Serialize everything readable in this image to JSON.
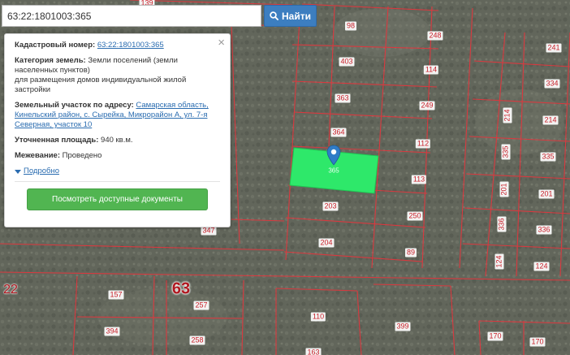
{
  "search": {
    "value": "63:22:1801003:365",
    "button_label": "Найти"
  },
  "popup": {
    "cadastral_label": "Кадастровый номер:",
    "cadastral_value": "63:22:1801003:365",
    "category_label": "Категория земель:",
    "category_value": "Земли поселений (земли населенных пунктов)",
    "purpose_value": "для размещения домов индивидуальной жилой застройки",
    "address_label": "Земельный участок по адресу:",
    "address_value": "Самарская область, Кинельский район, с. Сырейка, Микрорайон А, ул. 7-я Северная, участок 10",
    "area_label": "Уточненная площадь:",
    "area_value": "940 кв.м.",
    "survey_label": "Межевание:",
    "survey_value": "Проведено",
    "more_label": "Подробно",
    "docs_button": "Посмотреть доступные документы",
    "close_symbol": "×"
  },
  "selected_plot": {
    "label": "365",
    "color": "#2ee86a"
  },
  "colors": {
    "boundary": "#d9393f",
    "accent": "#3c7ec0",
    "docs_button": "#51b551"
  },
  "plots": [
    {
      "label": "98"
    },
    {
      "label": "248"
    },
    {
      "label": "241"
    },
    {
      "label": "403"
    },
    {
      "label": "114"
    },
    {
      "label": "334"
    },
    {
      "label": "363"
    },
    {
      "label": "249"
    },
    {
      "label": "214"
    },
    {
      "label": "214"
    },
    {
      "label": "364"
    },
    {
      "label": "112"
    },
    {
      "label": "335"
    },
    {
      "label": "335"
    },
    {
      "label": "113"
    },
    {
      "label": "201"
    },
    {
      "label": "201"
    },
    {
      "label": "203"
    },
    {
      "label": "250"
    },
    {
      "label": "336"
    },
    {
      "label": "336"
    },
    {
      "label": "204"
    },
    {
      "label": "89"
    },
    {
      "label": "124"
    },
    {
      "label": "124"
    },
    {
      "label": "157"
    },
    {
      "label": "257"
    },
    {
      "label": "394"
    },
    {
      "label": "258"
    },
    {
      "label": "110"
    },
    {
      "label": "399"
    },
    {
      "label": "170"
    },
    {
      "label": "170"
    },
    {
      "label": "347"
    },
    {
      "label": "139"
    },
    {
      "label": "163"
    }
  ],
  "quarters": [
    {
      "label": "63"
    },
    {
      "label": "22"
    }
  ]
}
